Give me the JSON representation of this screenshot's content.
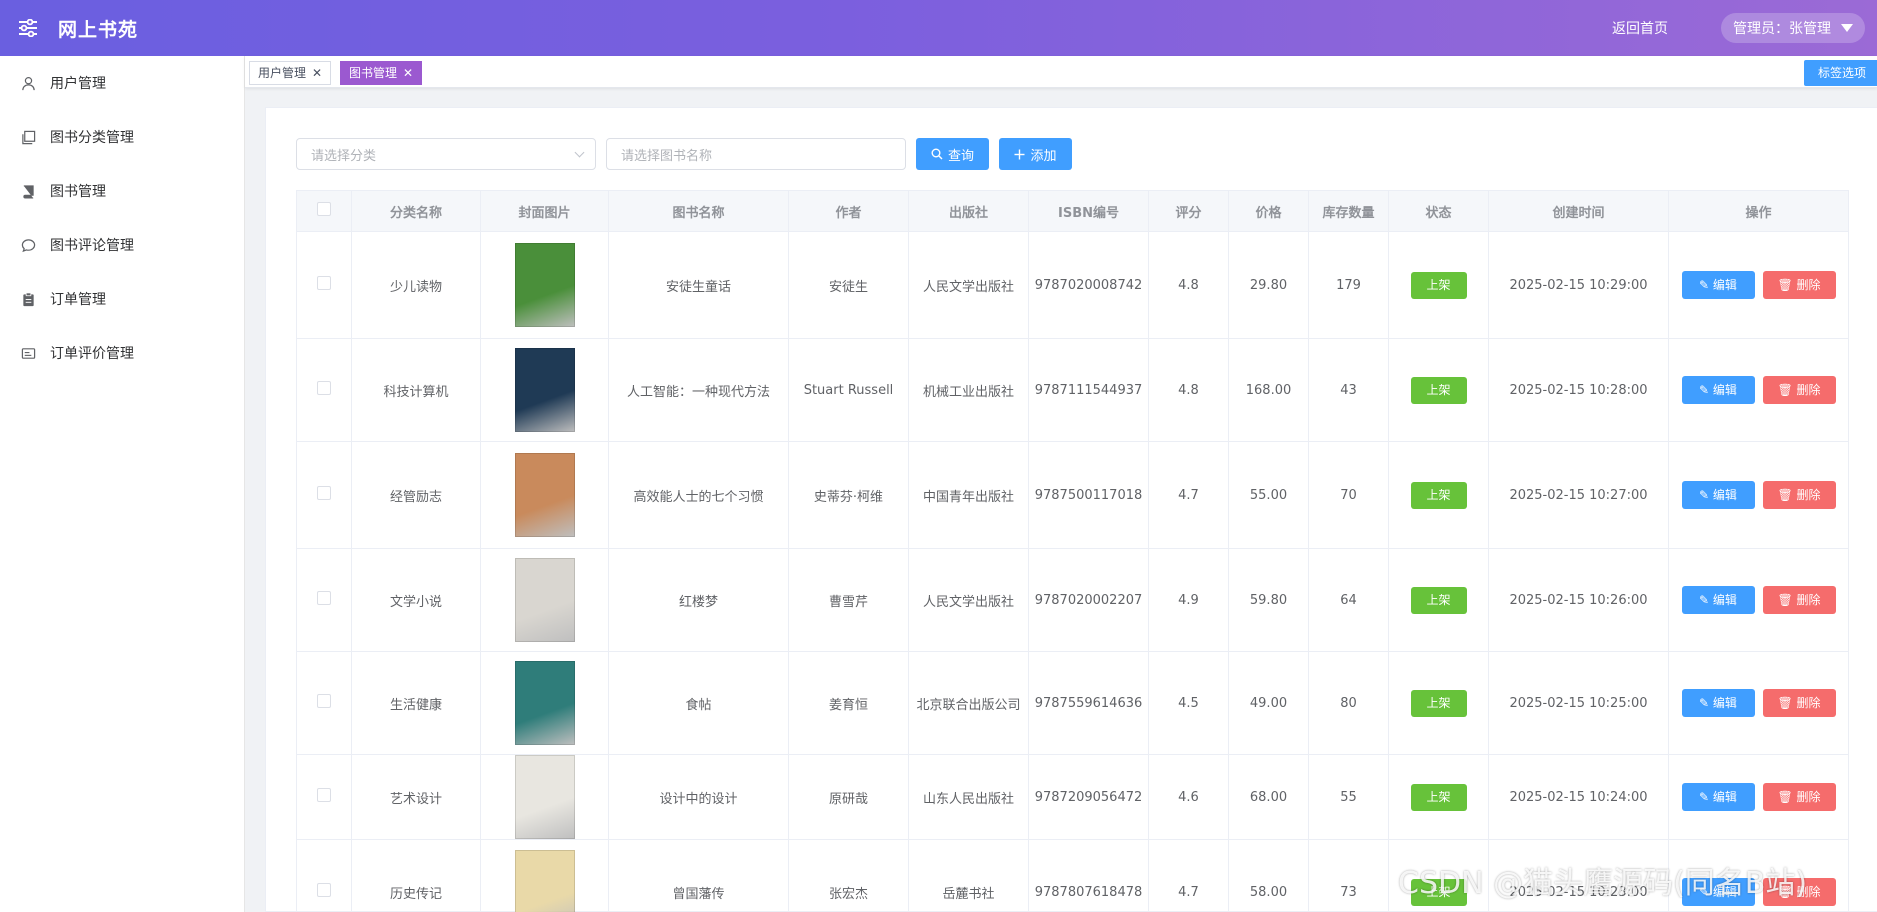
{
  "header": {
    "app_title": "网上书苑",
    "home_link": "返回首页",
    "admin_label": "管理员：张管理"
  },
  "sidebar": {
    "items": [
      {
        "label": "用户管理",
        "icon": "user-icon"
      },
      {
        "label": "图书分类管理",
        "icon": "copy-icon"
      },
      {
        "label": "图书管理",
        "icon": "book-icon"
      },
      {
        "label": "图书评论管理",
        "icon": "chat-bubble-icon"
      },
      {
        "label": "订单管理",
        "icon": "clipboard-icon"
      },
      {
        "label": "订单评价管理",
        "icon": "card-icon"
      }
    ]
  },
  "tabs": {
    "items": [
      {
        "label": "用户管理",
        "active": false
      },
      {
        "label": "图书管理",
        "active": true
      }
    ],
    "options_label": "标签选项"
  },
  "filters": {
    "category_placeholder": "请选择分类",
    "name_placeholder": "请选择图书名称",
    "search_label": "查询",
    "add_label": "添加"
  },
  "table": {
    "headers": [
      "分类名称",
      "封面图片",
      "图书名称",
      "作者",
      "出版社",
      "ISBN编号",
      "评分",
      "价格",
      "库存数量",
      "状态",
      "创建时间",
      "操作"
    ],
    "edit_label": "编辑",
    "delete_label": "删除",
    "rows": [
      {
        "category": "少儿读物",
        "name": "安徒生童话",
        "author": "安徒生",
        "publisher": "人民文学出版社",
        "isbn": "9787020008742",
        "rating": "4.8",
        "price": "29.80",
        "stock": "179",
        "status": "上架",
        "created": "2025-02-15 10:29:00",
        "cover_color": "#4a8f3a"
      },
      {
        "category": "科技计算机",
        "name": "人工智能：一种现代方法",
        "author": "Stuart Russell",
        "publisher": "机械工业出版社",
        "isbn": "9787111544937",
        "rating": "4.8",
        "price": "168.00",
        "stock": "43",
        "status": "上架",
        "created": "2025-02-15 10:28:00",
        "cover_color": "#1f3a55"
      },
      {
        "category": "经管励志",
        "name": "高效能人士的七个习惯",
        "author": "史蒂芬·柯维",
        "publisher": "中国青年出版社",
        "isbn": "9787500117018",
        "rating": "4.7",
        "price": "55.00",
        "stock": "70",
        "status": "上架",
        "created": "2025-02-15 10:27:00",
        "cover_color": "#c98a5c"
      },
      {
        "category": "文学小说",
        "name": "红楼梦",
        "author": "曹雪芹",
        "publisher": "人民文学出版社",
        "isbn": "9787020002207",
        "rating": "4.9",
        "price": "59.80",
        "stock": "64",
        "status": "上架",
        "created": "2025-02-15 10:26:00",
        "cover_color": "#d9d6d0"
      },
      {
        "category": "生活健康",
        "name": "食帖",
        "author": "姜育恒",
        "publisher": "北京联合出版公司",
        "isbn": "9787559614636",
        "rating": "4.5",
        "price": "49.00",
        "stock": "80",
        "status": "上架",
        "created": "2025-02-15 10:25:00",
        "cover_color": "#2f7d7a"
      },
      {
        "category": "艺术设计",
        "name": "设计中的设计",
        "author": "原研哉",
        "publisher": "山东人民出版社",
        "isbn": "9787209056472",
        "rating": "4.6",
        "price": "68.00",
        "stock": "55",
        "status": "上架",
        "created": "2025-02-15 10:24:00",
        "cover_color": "#e8e6e0"
      },
      {
        "category": "历史传记",
        "name": "曾国藩传",
        "author": "张宏杰",
        "publisher": "岳麓书社",
        "isbn": "9787807618478",
        "rating": "4.7",
        "price": "58.00",
        "stock": "73",
        "status": "上架",
        "created": "2025-02-15 10:23:00",
        "cover_color": "#e9d9a8"
      }
    ]
  },
  "watermark": "CSDN @猫头鹰源码(同名B站)"
}
